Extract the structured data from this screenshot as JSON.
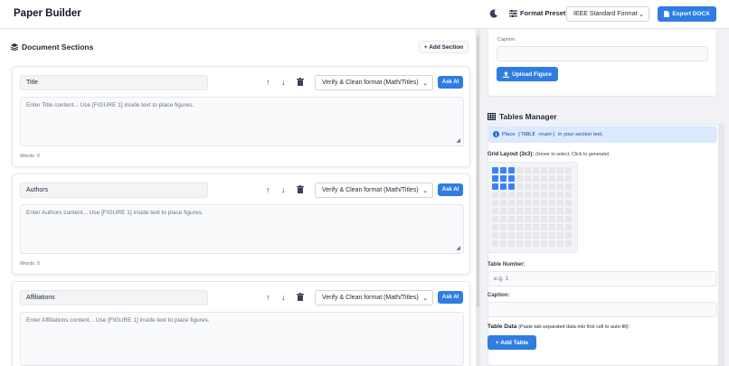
{
  "header": {
    "app_title": "Paper Builder",
    "format_preset_label": "Format Preset:",
    "format_preset_value": "IEEE Standard Format",
    "export_label": "Export DOCX"
  },
  "sections_panel": {
    "title": "Document Sections",
    "add_section_label": "+ Add Section",
    "ai_action": "Verify & Clean format (Math/Titles)",
    "ask_ai_label": "Ask AI",
    "cards": [
      {
        "name": "Title",
        "placeholder": "Enter Title content... Use [FIGURE 1] inside text to place figures.",
        "words": "Words: 0"
      },
      {
        "name": "Authors",
        "placeholder": "Enter Authors content... Use [FIGURE 1] inside text to place figures.",
        "words": "Words: 0"
      },
      {
        "name": "Affiliations",
        "placeholder": "Enter Affiliations content... Use [FIGURE 1] inside text to place figures.",
        "words": ""
      }
    ]
  },
  "figures": {
    "caption_label": "Caption:",
    "upload_label": "Upload Figure"
  },
  "tables": {
    "title": "Tables Manager",
    "info_prefix": "Place",
    "info_code": "[TABLE <num>]",
    "info_suffix": "in your section text.",
    "grid_label": "Grid Layout (3x3):",
    "grid_hint": "(Hover to select, Click to generate)",
    "grid_selected_cols": 3,
    "grid_selected_rows": 3,
    "table_number_label": "Table Number:",
    "table_number_placeholder": "e.g. 1",
    "caption_label": "Caption:",
    "table_data_label": "Table Data",
    "table_data_hint": "(Paste tab-separated data into first cell to auto-fill):",
    "add_table_label": "+ Add Table"
  },
  "colors": {
    "accent": "#2f7de1",
    "grid_selected": "#3b82f6",
    "info_bg": "#dbeafe"
  }
}
